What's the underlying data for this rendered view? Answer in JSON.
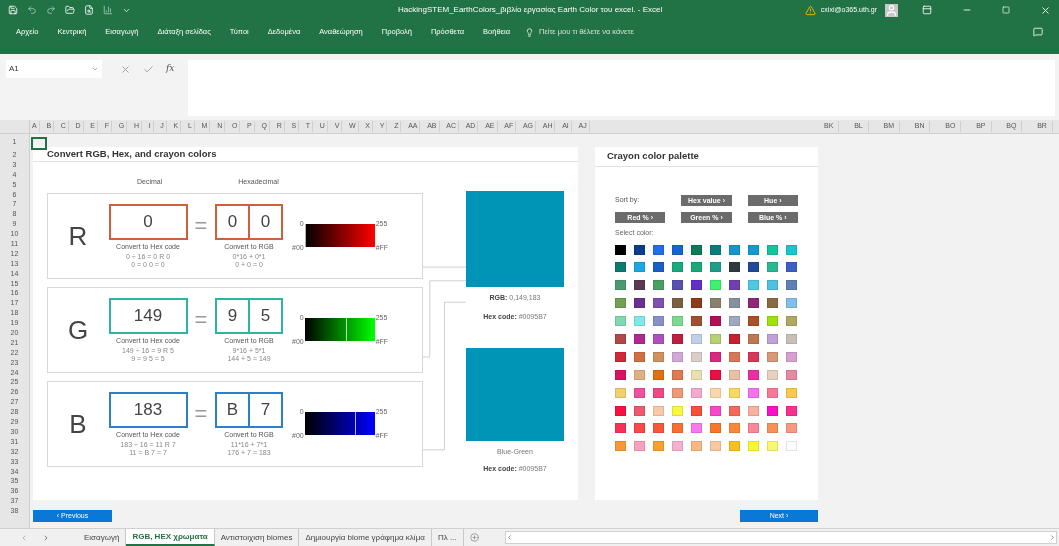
{
  "window": {
    "title": "HackingSTEM_EarthColors_βιβλίο εργασίας Earth Color του excel.  -  Excel",
    "user": "cxixi@o365.uth.gr"
  },
  "ribbon_tabs": [
    "Αρχείο",
    "Κεντρική",
    "Εισαγωγή",
    "Διάταξη σελίδας",
    "Τύποι",
    "Δεδομένα",
    "Αναθεώρηση",
    "Προβολή",
    "Πρόσθετα",
    "Βοήθεια"
  ],
  "tell_me": {
    "placeholder": "Πείτε μου τι θέλετε να κάνετε"
  },
  "formula_bar": {
    "name_box": "A1",
    "function_label": "fx"
  },
  "column_headers": [
    "A",
    "B",
    "C",
    "D",
    "E",
    "F",
    "G",
    "H",
    "I",
    "J",
    "K",
    "L",
    "M",
    "N",
    "O",
    "P",
    "Q",
    "R",
    "S",
    "T",
    "U",
    "V",
    "W",
    "X",
    "Y",
    "Z",
    "AA",
    "AB",
    "AC",
    "AD",
    "AE",
    "AF",
    "AG",
    "AH",
    "AI",
    "AJ"
  ],
  "column_headers_right": [
    "BK",
    "BL",
    "BM",
    "BN",
    "BO",
    "BP",
    "BQ",
    "BR"
  ],
  "row_headers": [
    "1",
    "2",
    "3",
    "4",
    "5",
    "6",
    "7",
    "8",
    "9",
    "10",
    "11",
    "12",
    "13",
    "14",
    "15",
    "16",
    "17",
    "18",
    "19",
    "20",
    "21",
    "22",
    "23",
    "24",
    "25",
    "26",
    "27",
    "28",
    "29",
    "30",
    "31",
    "32",
    "33",
    "34",
    "35",
    "36",
    "37",
    "38"
  ],
  "converter": {
    "title": "Convert RGB, Hex, and crayon colors",
    "decimal_label": "Decimal",
    "hex_label": "Hexadecimal",
    "channels": [
      {
        "letter": "R",
        "decimal": "0",
        "hex": [
          "0",
          "0"
        ],
        "equals": "=",
        "color": "#d0603a",
        "kind": "red",
        "level": 0,
        "hex_caption": "Convert to Hex code",
        "hex_steps": [
          "0 ÷ 16 = 0 R 0",
          "0 = 0   0 = 0"
        ],
        "rgb_caption": "Convert to RGB",
        "rgb_steps": [
          "0*16 + 0*1",
          "0 + 0 = 0"
        ],
        "min": "0",
        "max": "255",
        "min_hex": "#00",
        "max_hex": "#FF"
      },
      {
        "letter": "G",
        "decimal": "149",
        "hex": [
          "9",
          "5"
        ],
        "equals": "=",
        "color": "#2cb5a0",
        "kind": "green",
        "level": 0.584,
        "hex_caption": "Convert to Hex code",
        "hex_steps": [
          "149 ÷ 16 = 9 R 5",
          "9 = 9   5 = 5"
        ],
        "rgb_caption": "Convert to RGB",
        "rgb_steps": [
          "9*16 + 5*1",
          "144 + 5 = 149"
        ],
        "min": "0",
        "max": "255",
        "min_hex": "#00",
        "max_hex": "#FF"
      },
      {
        "letter": "B",
        "decimal": "183",
        "hex": [
          "B",
          "7"
        ],
        "equals": "=",
        "color": "#2e7ec8",
        "kind": "blue",
        "level": 0.718,
        "hex_caption": "Convert to Hex code",
        "hex_steps": [
          "183 ÷ 16 = 11 R 7",
          "11 = B   7 = 7"
        ],
        "rgb_caption": "Convert to RGB",
        "rgb_steps": [
          "11*16 + 7*1",
          "176 + 7 = 183"
        ],
        "min": "0",
        "max": "255",
        "min_hex": "#00",
        "max_hex": "#FF"
      }
    ],
    "preview": {
      "color": "#0095b7",
      "rgb_label": "RGB:",
      "rgb": "0,149,183",
      "hex_label": "Hex code:",
      "hex": "#0095B7"
    },
    "crayon_preview": {
      "color": "#0095b7",
      "name": "Blue-Green",
      "hex_label": "Hex code:",
      "hex": "#0095B7"
    }
  },
  "palette": {
    "title": "Crayon color palette",
    "sort_label": "Sort by:",
    "sort_buttons": [
      "Hex value ›",
      "Hue ›",
      "Red % ›",
      "Green % ›",
      "Blue % ›"
    ],
    "select_label": "Select color:",
    "swatches": [
      [
        {
          "color": "#000000"
        },
        {
          "color": "#0a3d8a"
        },
        {
          "color": "#1f6fe8"
        },
        {
          "color": "#1566d0"
        },
        {
          "color": "#0e7a5a"
        },
        {
          "color": "#0b7d7a"
        },
        {
          "color": "#1595c8"
        },
        {
          "color": "#1599d0"
        },
        {
          "color": "#14c49a"
        },
        {
          "color": "#14c8d0"
        }
      ],
      [
        {
          "color": "#0d7a70"
        },
        {
          "color": "#1aa8e0"
        },
        {
          "color": "#1a5fc8"
        },
        {
          "color": "#1aaa80"
        },
        {
          "color": "#1aaa78"
        },
        {
          "color": "#1f9f88"
        },
        {
          "color": "#2e3a40"
        },
        {
          "color": "#1f4a9a"
        },
        {
          "color": "#2ab890"
        },
        {
          "color": "#3a60c8"
        }
      ],
      [
        {
          "color": "#4a9a70"
        },
        {
          "color": "#5a3a50"
        },
        {
          "color": "#4aa060"
        },
        {
          "color": "#5a50b0"
        },
        {
          "color": "#6030c8"
        },
        {
          "color": "#40f070"
        },
        {
          "color": "#7040b0"
        },
        {
          "color": "#50c8e0"
        },
        {
          "color": "#50c0e0"
        },
        {
          "color": "#6080b8"
        }
      ],
      [
        {
          "color": "#70a050"
        },
        {
          "color": "#6a3090"
        },
        {
          "color": "#8050b0"
        },
        {
          "color": "#7a6040"
        },
        {
          "color": "#903a18"
        },
        {
          "color": "#8a8070"
        },
        {
          "color": "#8890a0"
        },
        {
          "color": "#902878"
        },
        {
          "color": "#8a6a40"
        },
        {
          "color": "#80c0e8"
        }
      ],
      [
        {
          "color": "#80d8b0"
        },
        {
          "color": "#80e8e8"
        },
        {
          "color": "#8890c8"
        },
        {
          "color": "#80d890"
        },
        {
          "color": "#a05030"
        },
        {
          "color": "#b01058"
        },
        {
          "color": "#a0a8c0"
        },
        {
          "color": "#a85028"
        },
        {
          "color": "#a0e010"
        },
        {
          "color": "#b0a860"
        }
      ],
      [
        {
          "color": "#b04848"
        },
        {
          "color": "#b02890"
        },
        {
          "color": "#b050c0"
        },
        {
          "color": "#c02040"
        },
        {
          "color": "#c0d0e8"
        },
        {
          "color": "#b8d070"
        },
        {
          "color": "#c82030"
        },
        {
          "color": "#c07850"
        },
        {
          "color": "#c0a0d8"
        },
        {
          "color": "#c8c0b8"
        }
      ],
      [
        {
          "color": "#d02838"
        },
        {
          "color": "#d07040"
        },
        {
          "color": "#d09060"
        },
        {
          "color": "#d0a8d8"
        },
        {
          "color": "#d8d0c8"
        },
        {
          "color": "#d82880"
        },
        {
          "color": "#d87858"
        },
        {
          "color": "#d83858"
        },
        {
          "color": "#d89878"
        },
        {
          "color": "#d8a0d0"
        }
      ],
      [
        {
          "color": "#e01060"
        },
        {
          "color": "#e0b080"
        },
        {
          "color": "#e07010"
        },
        {
          "color": "#e07850"
        },
        {
          "color": "#e8e0b0"
        },
        {
          "color": "#e81040"
        },
        {
          "color": "#e8c0a8"
        },
        {
          "color": "#e830a0"
        },
        {
          "color": "#e8d0c0"
        },
        {
          "color": "#e888a0"
        }
      ],
      [
        {
          "color": "#f0d070"
        },
        {
          "color": "#f050a0"
        },
        {
          "color": "#f04880"
        },
        {
          "color": "#f09878"
        },
        {
          "color": "#f8a8d0"
        },
        {
          "color": "#f8d8a8"
        },
        {
          "color": "#f8d860"
        },
        {
          "color": "#f870f0"
        },
        {
          "color": "#f87898"
        },
        {
          "color": "#f8c850"
        }
      ],
      [
        {
          "color": "#f81040"
        },
        {
          "color": "#f05870"
        },
        {
          "color": "#f8c8a8"
        },
        {
          "color": "#f8f840"
        },
        {
          "color": "#f85038"
        },
        {
          "color": "#f848c8"
        },
        {
          "color": "#f86858"
        },
        {
          "color": "#f8b0a0"
        },
        {
          "color": "#f810c8"
        },
        {
          "color": "#f83090"
        }
      ],
      [
        {
          "color": "#f83058"
        },
        {
          "color": "#f84848"
        },
        {
          "color": "#f85838"
        },
        {
          "color": "#f87030"
        },
        {
          "color": "#f878f0"
        },
        {
          "color": "#f87828"
        },
        {
          "color": "#f88838"
        },
        {
          "color": "#f88898"
        },
        {
          "color": "#f89058"
        },
        {
          "color": "#f89880"
        }
      ],
      [
        {
          "color": "#f89838"
        },
        {
          "color": "#f8a0c0"
        },
        {
          "color": "#f8a030"
        },
        {
          "color": "#f8b0d0"
        },
        {
          "color": "#f8b880"
        },
        {
          "color": "#f8c8a0"
        },
        {
          "color": "#f8c020"
        },
        {
          "color": "#f8f830"
        },
        {
          "color": "#f8f870"
        },
        {
          "color": "#fdfdfd"
        }
      ]
    ]
  },
  "nav": {
    "previous": "‹ Previous",
    "next": "Next ›"
  },
  "sheet_tabs": [
    {
      "label": "Εισαγωγή",
      "selected": false
    },
    {
      "label": "RGB, HEX χρωματα",
      "selected": true
    },
    {
      "label": "Αντιστοιχιση biomes",
      "selected": false
    },
    {
      "label": "Δημιουργία biome γράφημα κλίμα",
      "selected": false
    },
    {
      "label": "Πλ ...",
      "selected": false
    }
  ]
}
